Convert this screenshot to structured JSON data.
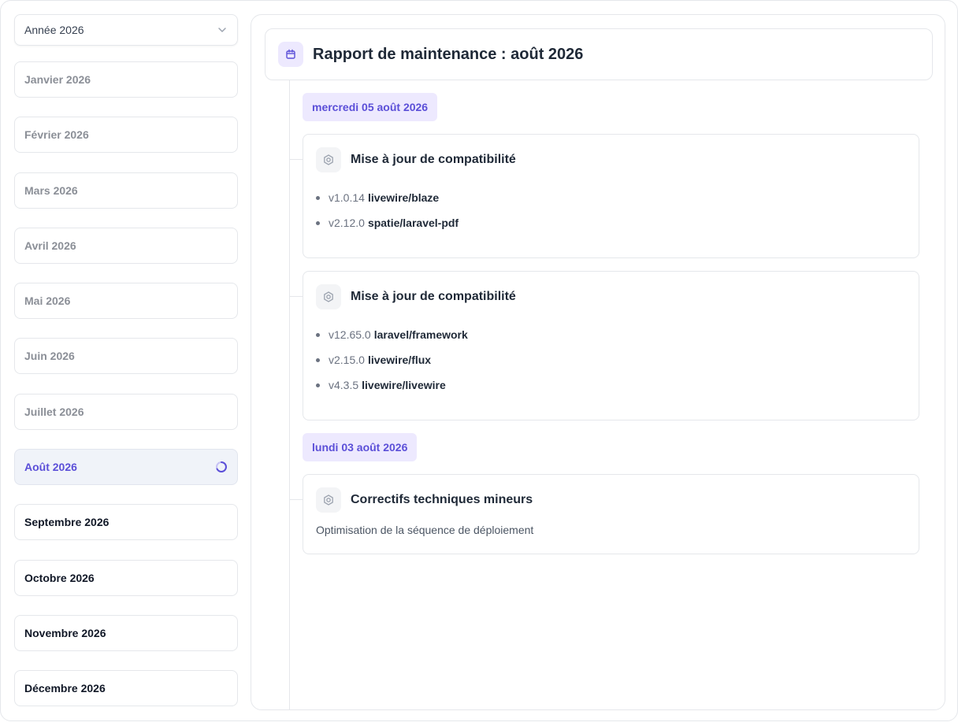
{
  "sidebar": {
    "year_select": "Année 2026",
    "months": [
      {
        "label": "Janvier 2026",
        "state": "past"
      },
      {
        "label": "Février 2026",
        "state": "past"
      },
      {
        "label": "Mars 2026",
        "state": "past"
      },
      {
        "label": "Avril 2026",
        "state": "past"
      },
      {
        "label": "Mai 2026",
        "state": "past"
      },
      {
        "label": "Juin 2026",
        "state": "past"
      },
      {
        "label": "Juillet 2026",
        "state": "past"
      },
      {
        "label": "Août 2026",
        "state": "active"
      },
      {
        "label": "Septembre 2026",
        "state": "future"
      },
      {
        "label": "Octobre 2026",
        "state": "future"
      },
      {
        "label": "Novembre 2026",
        "state": "future"
      },
      {
        "label": "Décembre 2026",
        "state": "future"
      }
    ]
  },
  "main": {
    "title": "Rapport de maintenance : août 2026",
    "dates": [
      {
        "label": "mercredi 05 août 2026",
        "entries": [
          {
            "title": "Mise à jour de compatibilité",
            "packages": [
              {
                "version": "v1.0.14",
                "name": "livewire/blaze"
              },
              {
                "version": "v2.12.0",
                "name": "spatie/laravel-pdf"
              }
            ]
          },
          {
            "title": "Mise à jour de compatibilité",
            "packages": [
              {
                "version": "v12.65.0",
                "name": "laravel/framework"
              },
              {
                "version": "v2.15.0",
                "name": "livewire/flux"
              },
              {
                "version": "v4.3.5",
                "name": "livewire/livewire"
              }
            ]
          }
        ]
      },
      {
        "label": "lundi 03 août 2026",
        "entries": [
          {
            "title": "Correctifs techniques mineurs",
            "description": "Optimisation de la séquence de déploiement"
          }
        ]
      }
    ]
  },
  "colors": {
    "accent": "#5b4fd8",
    "accent_bg": "#ede9fe",
    "active_bg": "#f0f3f9",
    "border": "#e5e7eb"
  },
  "icons": {
    "year_select": "chevron-down-icon",
    "active_month": "loading-spinner-icon",
    "header": "calendar-icon",
    "entry": "gear-icon"
  }
}
